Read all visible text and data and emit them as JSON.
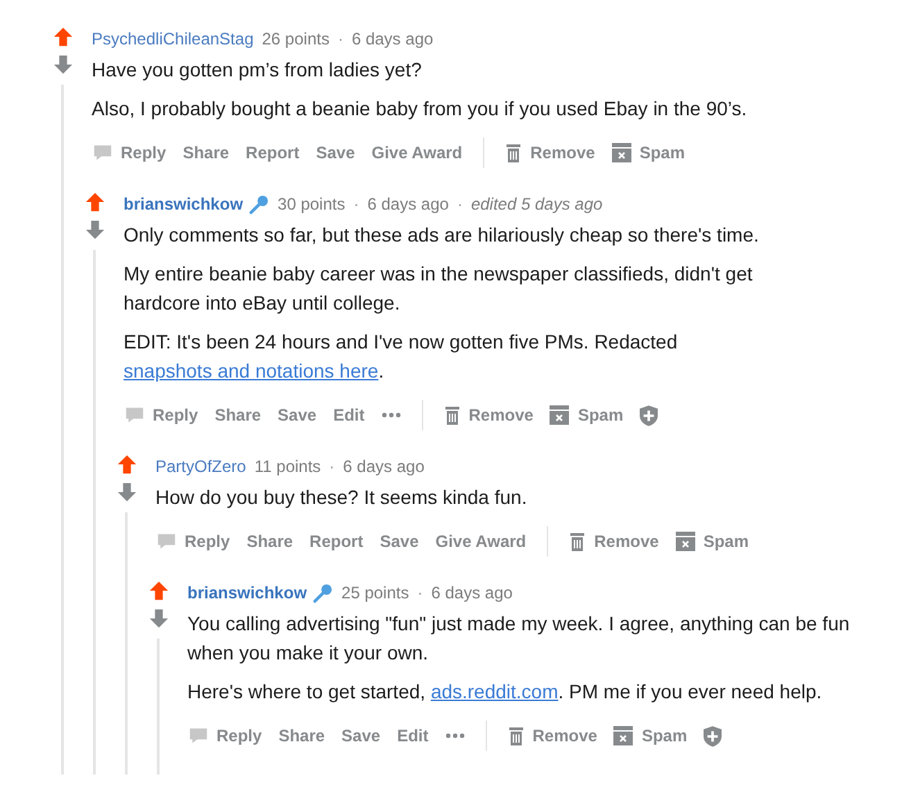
{
  "comments": [
    {
      "author": "PsychedliChileanStag",
      "mic_badge": false,
      "upvoted": true,
      "meta": [
        {
          "kind": "points",
          "text": "26 points"
        },
        {
          "kind": "dot",
          "text": "·"
        },
        {
          "kind": "time",
          "text": "6 days ago"
        }
      ],
      "paragraphs": [
        [
          {
            "kind": "text",
            "text": "Have you gotten pm’s from ladies yet?"
          }
        ],
        [
          {
            "kind": "text",
            "text": "Also, I probably bought a beanie baby from you if you used Ebay in the 90’s."
          }
        ]
      ],
      "actions": [
        {
          "kind": "reply",
          "label": "Reply"
        },
        {
          "kind": "plain",
          "label": "Share"
        },
        {
          "kind": "plain",
          "label": "Report"
        },
        {
          "kind": "plain",
          "label": "Save"
        },
        {
          "kind": "plain",
          "label": "Give Award"
        }
      ],
      "mod_actions": [
        {
          "kind": "remove",
          "label": "Remove"
        },
        {
          "kind": "spam",
          "label": "Spam"
        }
      ],
      "children": [
        {
          "author": "brianswichkow",
          "mic_badge": true,
          "upvoted": true,
          "meta": [
            {
              "kind": "points",
              "text": "30 points"
            },
            {
              "kind": "dot",
              "text": "·"
            },
            {
              "kind": "time",
              "text": "6 days ago"
            },
            {
              "kind": "dot",
              "text": "·"
            },
            {
              "kind": "edited",
              "text": "edited 5 days ago"
            }
          ],
          "paragraphs": [
            [
              {
                "kind": "text",
                "text": "Only comments so far, but these ads are hilariously cheap so there's time."
              }
            ],
            [
              {
                "kind": "text",
                "text": "My entire beanie baby career was in the newspaper classifieds, didn't get hardcore into eBay until college."
              }
            ],
            [
              {
                "kind": "text",
                "text": "EDIT: It's been 24 hours and I've now gotten five PMs. Redacted "
              },
              {
                "kind": "link",
                "text": "snapshots and notations here"
              },
              {
                "kind": "text",
                "text": "."
              }
            ]
          ],
          "actions": [
            {
              "kind": "reply",
              "label": "Reply"
            },
            {
              "kind": "plain",
              "label": "Share"
            },
            {
              "kind": "plain",
              "label": "Save"
            },
            {
              "kind": "plain",
              "label": "Edit"
            },
            {
              "kind": "more"
            }
          ],
          "mod_actions": [
            {
              "kind": "remove",
              "label": "Remove"
            },
            {
              "kind": "spam",
              "label": "Spam"
            },
            {
              "kind": "shield"
            }
          ],
          "children": [
            {
              "author": "PartyOfZero",
              "mic_badge": false,
              "upvoted": true,
              "meta": [
                {
                  "kind": "points",
                  "text": "11 points"
                },
                {
                  "kind": "dot",
                  "text": "·"
                },
                {
                  "kind": "time",
                  "text": "6 days ago"
                }
              ],
              "paragraphs": [
                [
                  {
                    "kind": "text",
                    "text": "How do you buy these? It seems kinda fun."
                  }
                ]
              ],
              "actions": [
                {
                  "kind": "reply",
                  "label": "Reply"
                },
                {
                  "kind": "plain",
                  "label": "Share"
                },
                {
                  "kind": "plain",
                  "label": "Report"
                },
                {
                  "kind": "plain",
                  "label": "Save"
                },
                {
                  "kind": "plain",
                  "label": "Give Award"
                }
              ],
              "mod_actions": [
                {
                  "kind": "remove",
                  "label": "Remove"
                },
                {
                  "kind": "spam",
                  "label": "Spam"
                }
              ],
              "children": [
                {
                  "author": "brianswichkow",
                  "mic_badge": true,
                  "upvoted": true,
                  "meta": [
                    {
                      "kind": "points",
                      "text": "25 points"
                    },
                    {
                      "kind": "dot",
                      "text": "·"
                    },
                    {
                      "kind": "time",
                      "text": "6 days ago"
                    }
                  ],
                  "paragraphs": [
                    [
                      {
                        "kind": "text",
                        "text": "You calling advertising \"fun\" just made my week. I agree, anything can be fun when you make it your own."
                      }
                    ],
                    [
                      {
                        "kind": "text",
                        "text": "Here's where to get started, "
                      },
                      {
                        "kind": "link",
                        "text": "ads.reddit.com"
                      },
                      {
                        "kind": "text",
                        "text": ". PM me if you ever need help."
                      }
                    ]
                  ],
                  "actions": [
                    {
                      "kind": "reply",
                      "label": "Reply"
                    },
                    {
                      "kind": "plain",
                      "label": "Share"
                    },
                    {
                      "kind": "plain",
                      "label": "Save"
                    },
                    {
                      "kind": "plain",
                      "label": "Edit"
                    },
                    {
                      "kind": "more"
                    }
                  ],
                  "mod_actions": [
                    {
                      "kind": "remove",
                      "label": "Remove"
                    },
                    {
                      "kind": "spam",
                      "label": "Spam"
                    },
                    {
                      "kind": "shield"
                    }
                  ]
                }
              ]
            }
          ]
        }
      ]
    }
  ]
}
